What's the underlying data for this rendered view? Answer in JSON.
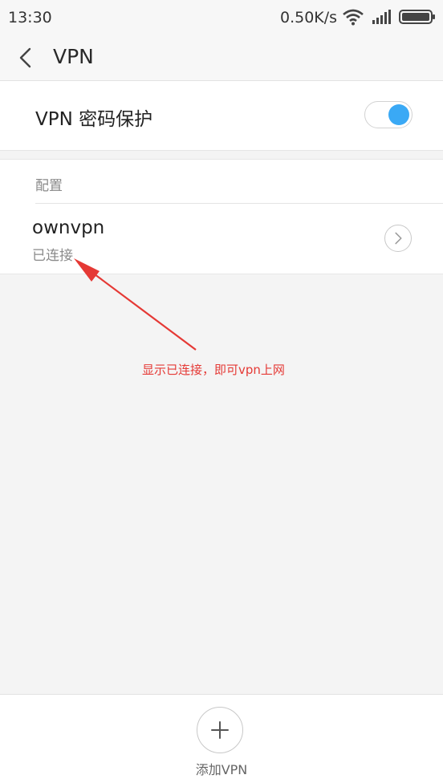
{
  "status_bar": {
    "time": "13:30",
    "network_speed": "0.50K/s",
    "icons": [
      "wifi-icon",
      "signal-icon",
      "battery-icon"
    ]
  },
  "header": {
    "back_icon": "chevron-left-icon",
    "title": "VPN"
  },
  "password_protection": {
    "label": "VPN 密码保护",
    "enabled": true
  },
  "config_section": {
    "header": "配置",
    "items": [
      {
        "name": "ownvpn",
        "status": "已连接",
        "icon": "chevron-right-icon"
      }
    ]
  },
  "annotation": {
    "text": "显示已连接，即可vpn上网",
    "color": "#e53935"
  },
  "bottom": {
    "add_icon": "plus-icon",
    "add_label": "添加VPN"
  },
  "colors": {
    "accent": "#3aa9f5",
    "annotation": "#e53935"
  }
}
